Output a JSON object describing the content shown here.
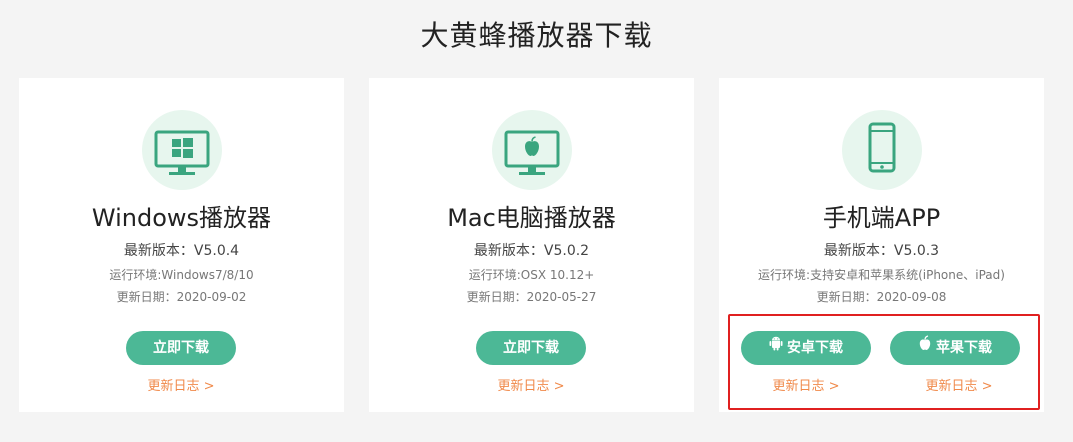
{
  "page": {
    "title": "大黄蜂播放器下载"
  },
  "cards": [
    {
      "title": "Windows播放器",
      "version": "最新版本：V5.0.4",
      "env": "运行环境:Windows7/8/10",
      "date": "更新日期：2020-09-02",
      "download_label": "立即下载",
      "changelog_label": "更新日志 >"
    },
    {
      "title": "Mac电脑播放器",
      "version": "最新版本：V5.0.2",
      "env": "运行环境:OSX 10.12+",
      "date": "更新日期：2020-05-27",
      "download_label": "立即下载",
      "changelog_label": "更新日志 >"
    },
    {
      "title": "手机端APP",
      "version": "最新版本：V5.0.3",
      "env": "运行环境:支持安卓和苹果系统(iPhone、iPad)",
      "date": "更新日期：2020-09-08",
      "android_label": "安卓下载",
      "ios_label": "苹果下载",
      "android_changelog_label": "更新日志 >",
      "ios_changelog_label": "更新日志 >"
    }
  ],
  "colors": {
    "accent": "#4cb896",
    "icon_bg": "#e7f6ee",
    "changelog": "#f08a4b",
    "highlight": "#e02020"
  },
  "icons": [
    "windows-monitor-icon",
    "apple-monitor-icon",
    "phone-icon",
    "android-icon",
    "apple-icon"
  ]
}
